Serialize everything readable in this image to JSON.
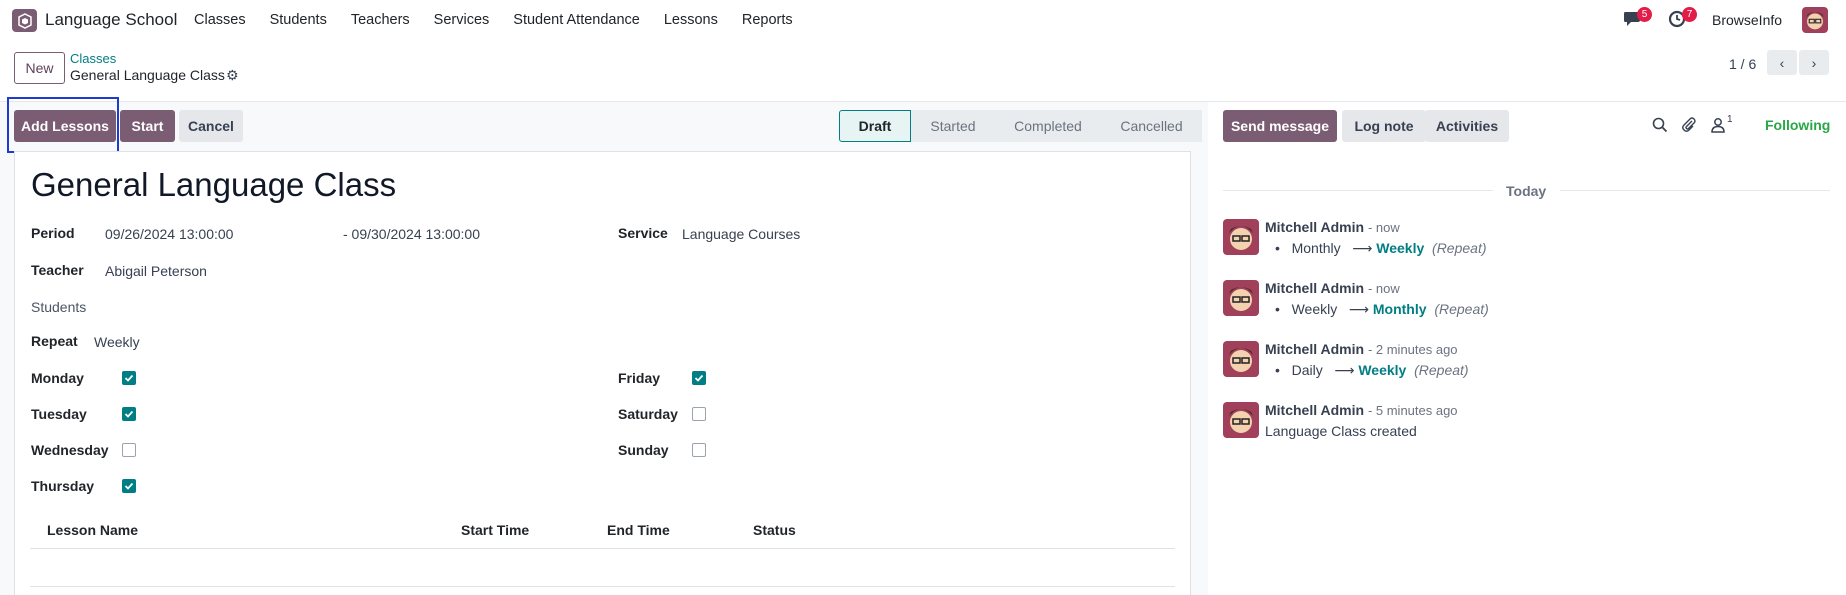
{
  "navbar": {
    "brand": "Language School",
    "menu": [
      "Classes",
      "Students",
      "Teachers",
      "Services",
      "Student Attendance",
      "Lessons",
      "Reports"
    ],
    "messages_badge": "5",
    "activities_badge": "7",
    "company": "BrowseInfo"
  },
  "control": {
    "new_label": "New",
    "breadcrumb_parent": "Classes",
    "breadcrumb_current": "General Language Class",
    "pager": "1 / 6"
  },
  "statusbar": {
    "buttons": [
      "Add Lessons",
      "Start",
      "Cancel"
    ],
    "stages": [
      "Draft",
      "Started",
      "Completed",
      "Cancelled"
    ],
    "active_stage": "Draft"
  },
  "form": {
    "title": "General Language Class",
    "period_label": "Period",
    "period_start": "09/26/2024 13:00:00",
    "period_end": "- 09/30/2024 13:00:00",
    "service_label": "Service",
    "service_value": "Language Courses",
    "teacher_label": "Teacher",
    "teacher_value": "Abigail Peterson",
    "students_label": "Students",
    "repeat_label": "Repeat",
    "repeat_value": "Weekly",
    "days": {
      "monday": {
        "label": "Monday",
        "checked": true
      },
      "tuesday": {
        "label": "Tuesday",
        "checked": true
      },
      "wednesday": {
        "label": "Wednesday",
        "checked": false
      },
      "thursday": {
        "label": "Thursday",
        "checked": true
      },
      "friday": {
        "label": "Friday",
        "checked": true
      },
      "saturday": {
        "label": "Saturday",
        "checked": false
      },
      "sunday": {
        "label": "Sunday",
        "checked": false
      }
    },
    "table_headers": [
      "Lesson Name",
      "Start Time",
      "End Time",
      "Status"
    ]
  },
  "chatter": {
    "send_message": "Send message",
    "log_note": "Log note",
    "activities": "Activities",
    "followers_count": "1",
    "following": "Following",
    "today": "Today",
    "messages": [
      {
        "author": "Mitchell Admin",
        "time": "- now",
        "old": "Monthly",
        "new": "Weekly",
        "field": "(Repeat)"
      },
      {
        "author": "Mitchell Admin",
        "time": "- now",
        "old": "Weekly",
        "new": "Monthly",
        "field": "(Repeat)"
      },
      {
        "author": "Mitchell Admin",
        "time": "- 2 minutes ago",
        "old": "Daily",
        "new": "Weekly",
        "field": "(Repeat)"
      },
      {
        "author": "Mitchell Admin",
        "time": "- 5 minutes ago",
        "body": "Language Class created"
      }
    ]
  }
}
